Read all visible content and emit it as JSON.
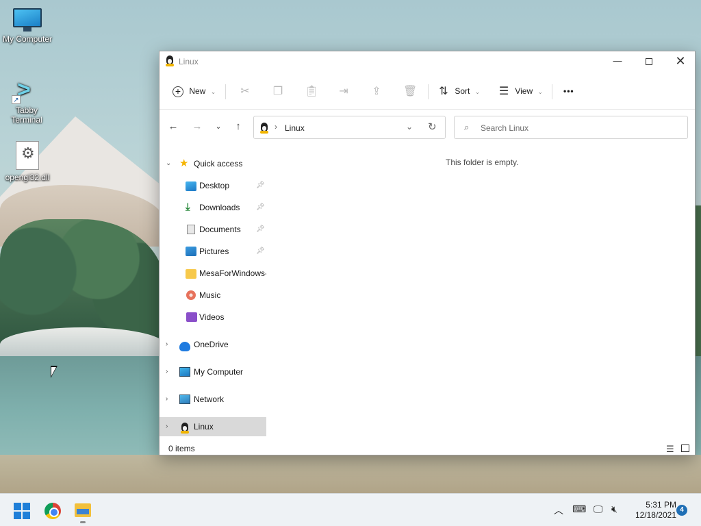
{
  "desktop": {
    "icons": [
      {
        "label": "My Computer",
        "icon": "monitor-icon"
      },
      {
        "label": "Tabby Terminal",
        "icon": "tabby-icon"
      },
      {
        "label": "opengl32.dll",
        "icon": "dll-file-icon"
      }
    ]
  },
  "window": {
    "title": "Linux",
    "title_icon": "penguin-icon",
    "controls": {
      "minimize": "—",
      "maximize": "",
      "close": "✕"
    }
  },
  "toolbar": {
    "new_label": "New",
    "sort_label": "Sort",
    "view_label": "View",
    "more_label": "•••",
    "disabled_icons": [
      "cut-icon",
      "copy-icon",
      "paste-icon",
      "rename-icon",
      "share-icon",
      "delete-icon"
    ]
  },
  "navigation": {
    "back": "←",
    "forward": "→",
    "recent": "⌄",
    "up": "↑",
    "address": {
      "separator": "›",
      "path": "Linux"
    },
    "search_placeholder": "Search Linux"
  },
  "sidebar": {
    "quick_access": "Quick access",
    "items": [
      {
        "label": "Desktop",
        "pinned": true
      },
      {
        "label": "Downloads",
        "pinned": true
      },
      {
        "label": "Documents",
        "pinned": true
      },
      {
        "label": "Pictures",
        "pinned": true
      },
      {
        "label": "MesaForWindows-",
        "pinned": false
      },
      {
        "label": "Music",
        "pinned": false
      },
      {
        "label": "Videos",
        "pinned": false
      }
    ],
    "roots": [
      {
        "label": "OneDrive"
      },
      {
        "label": "My Computer"
      },
      {
        "label": "Network"
      },
      {
        "label": "Linux",
        "selected": true
      }
    ]
  },
  "content": {
    "empty_message": "This folder is empty."
  },
  "status": {
    "item_count": "0 items"
  },
  "taskbar": {
    "apps": [
      "start-icon",
      "chrome-icon",
      "file-explorer-icon"
    ],
    "tray": [
      "chevron-up-icon",
      "keyboard-icon",
      "display-icon",
      "volume-muted-icon"
    ],
    "time": "5:31 PM",
    "date": "12/18/2021",
    "notification_count": "4"
  }
}
